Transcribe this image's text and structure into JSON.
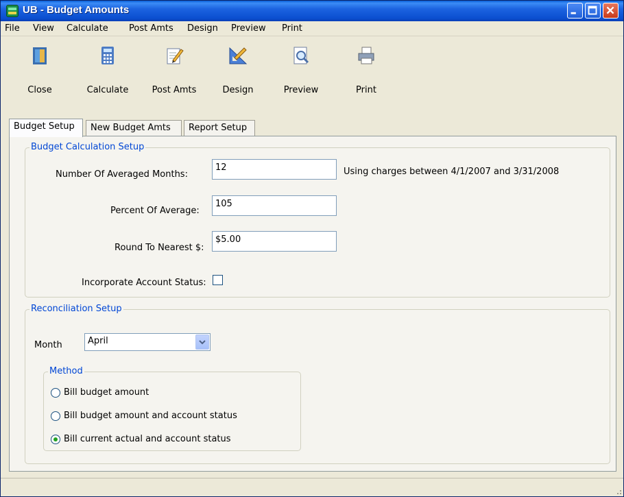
{
  "window": {
    "title": "UB - Budget Amounts"
  },
  "menu": [
    "File",
    "View",
    "Calculate",
    "Post Amts",
    "Design",
    "Preview",
    "Print"
  ],
  "toolbar": {
    "close": "Close",
    "calculate": "Calculate",
    "post_amts": "Post Amts",
    "design": "Design",
    "preview": "Preview",
    "print": "Print"
  },
  "tabs": [
    "Budget Setup",
    "New Budget Amts",
    "Report Setup"
  ],
  "active_tab": "Budget Setup",
  "budget_calc": {
    "legend": "Budget Calculation Setup",
    "months_label": "Number Of Averaged Months:",
    "months_value": "12",
    "months_note": "Using charges between 4/1/2007 and 3/31/2008",
    "percent_label": "Percent Of Average:",
    "percent_value": "105",
    "round_label": "Round To Nearest $:",
    "round_value": "$5.00",
    "incorporate_label": "Incorporate Account Status:",
    "incorporate_checked": false
  },
  "reconciliation": {
    "legend": "Reconciliation Setup",
    "month_label": "Month",
    "month_value": "April",
    "method_legend": "Method",
    "methods": [
      "Bill budget amount",
      "Bill budget amount and account status",
      "Bill current actual and account status"
    ],
    "selected_method": "Bill current actual and account status"
  },
  "colors": {
    "title_bar": "#0b4fd0",
    "group_legend": "#0046d5",
    "face": "#ece9d8"
  }
}
